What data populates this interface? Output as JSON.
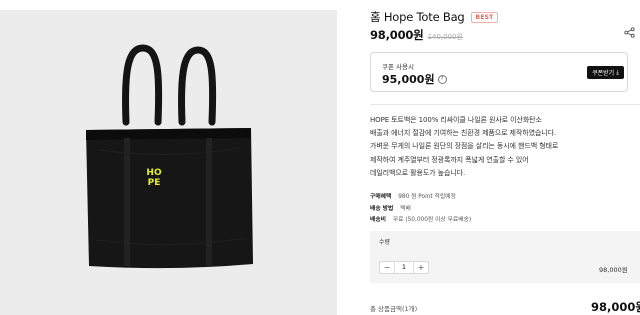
{
  "product": {
    "title": "홈 Hope Tote Bag",
    "badge": "BEST",
    "price": "98,000원",
    "original_price": "140,000원"
  },
  "coupon": {
    "label": "쿠폰 사용시",
    "price": "95,000원",
    "button_label": "쿠폰받기"
  },
  "bag_print": {
    "logo_text": "HOPE",
    "logo_color": "#e6ef2a"
  },
  "description": [
    "HOPE 토트백은 100% 리싸이클 나일론 원사로 이산화탄소",
    "배출과 에너지 절감에 기여하는 친환경 제품으로 제작하였습니다.",
    "가벼운 무게의 나일론 원단의 장점을 살리는 동시에 핸드백 형태로",
    "제작하여 계주열부터 정광록까지 폭넓게 연출할 수 있어",
    "데일리백으로 활용도가 높습니다."
  ],
  "meta": [
    {
      "key": "구매혜택",
      "value": "980 원 Point 적립예정"
    },
    {
      "key": "배송 방법",
      "value": "택배"
    },
    {
      "key": "배송비",
      "value": "무료 (50,000원 이상 무료배송)"
    }
  ],
  "quantity": {
    "label": "수량",
    "value": "1",
    "minus": "−",
    "plus": "+",
    "line_price": "98,000원"
  },
  "total": {
    "label": "총 상품금액(1개)",
    "price": "98,000원"
  },
  "colors": {
    "accent_badge": "#e0665b",
    "bag": "#161616"
  }
}
